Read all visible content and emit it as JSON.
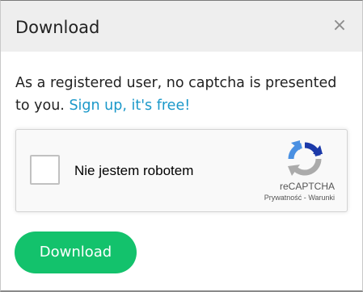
{
  "dialog": {
    "title": "Download",
    "close_glyph": "×",
    "close_icon": "close-icon"
  },
  "message": {
    "text": "As a registered user, no captcha is presented to you.",
    "link_text": "Sign up, it's free!"
  },
  "recaptcha": {
    "checkbox_label": "Nie jestem robotem",
    "brand": "reCAPTCHA",
    "privacy_link": "Prywatność",
    "separator": "-",
    "terms_link": "Warunki",
    "logo_icon": "recaptcha-logo-icon",
    "checked": false
  },
  "actions": {
    "download_label": "Download"
  },
  "colors": {
    "header_bg": "#eeeeee",
    "link": "#1a98c9",
    "primary_button": "#13c26c",
    "recaptcha_blue_dark": "#1c3aa9",
    "recaptcha_blue": "#4a90e2",
    "recaptcha_gray": "#ababab"
  }
}
